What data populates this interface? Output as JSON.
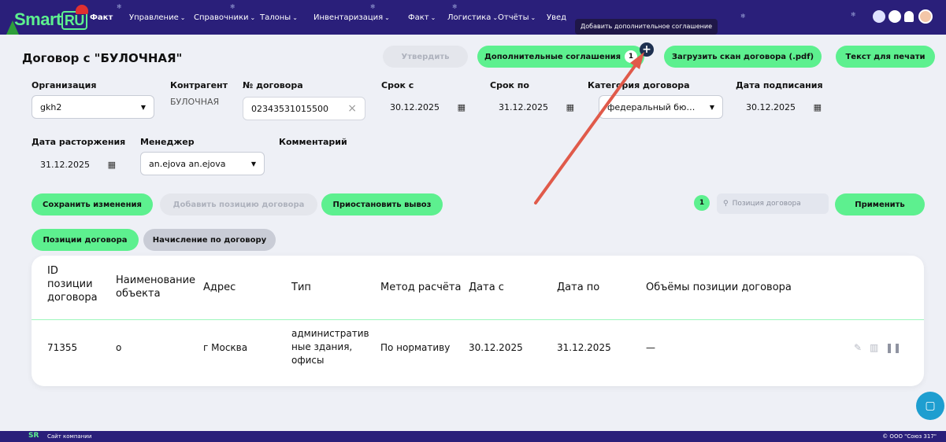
{
  "nav": {
    "logo_main": "Smart",
    "logo_ru": "RU",
    "items": [
      {
        "label": "Факт",
        "chev": ""
      },
      {
        "label": "Управление",
        "chev": "⌄"
      },
      {
        "label": "Справочники",
        "chev": "⌄"
      },
      {
        "label": "Талоны",
        "chev": "⌄"
      },
      {
        "label": "Инвентаризация",
        "chev": "⌄"
      },
      {
        "label": "Факт",
        "chev": "⌄"
      },
      {
        "label": "Логистика",
        "chev": "⌄"
      },
      {
        "label": "Отчёты",
        "chev": "⌄"
      },
      {
        "label": "Увед",
        "chev": ""
      }
    ],
    "tooltip": "Добавить дополнительное соглашение"
  },
  "header": {
    "title": "Договор с \"БУЛОЧНАЯ\"",
    "approve": "Утвердить",
    "additional": "Дополнительные соглашения",
    "additional_count": "1",
    "plus": "+",
    "upload": "Загрузить скан договора (.pdf)",
    "print": "Текст для печати"
  },
  "form": {
    "org_label": "Организация",
    "org_value": "gkh2",
    "contractor_label": "Контрагент",
    "contractor_value": "БУЛОЧНАЯ",
    "number_label": "№ договора",
    "number_value": "02343531015500",
    "from_label": "Срок с",
    "from_value": "30.12.2025",
    "to_label": "Срок по",
    "to_value": "31.12.2025",
    "category_label": "Категория договора",
    "category_value": "федеральный бю…",
    "signed_label": "Дата подписания",
    "signed_value": "30.12.2025",
    "terminate_label": "Дата расторжения",
    "terminate_value": "31.12.2025",
    "manager_label": "Менеджер",
    "manager_value": "an.ejova an.ejova",
    "comment_label": "Комментарий"
  },
  "actions": {
    "save": "Сохранить изменения",
    "add_position": "Добавить позицию договора",
    "suspend": "Приостановить вывоз",
    "count": "1",
    "search_placeholder": "Позиция договора",
    "apply": "Применить"
  },
  "tabs": {
    "positions": "Позиции договора",
    "accrual": "Начисление по договору"
  },
  "table": {
    "headers": {
      "id": [
        "ID",
        "позиции",
        "договора"
      ],
      "name": [
        "Наименование",
        "объекта"
      ],
      "address": "Адрес",
      "type": "Тип",
      "method": "Метод расчёта",
      "from": "Дата с",
      "to": "Дата по",
      "volumes": "Объёмы позиции договора"
    },
    "row": {
      "id": "71355",
      "name": "о",
      "address": "г Москва",
      "type": [
        "административ",
        "ные здания,",
        "офисы"
      ],
      "method": "По нормативу",
      "from": "30.12.2025",
      "to": "31.12.2025",
      "volumes": "—"
    }
  },
  "footer": {
    "logo": "SR",
    "site": "Сайт компании",
    "copyright": "© ООО \"Союз 317\""
  },
  "colors": {
    "nav_bg": "#2a1f7a",
    "accent_green": "#5df08f",
    "arrow": "#e05a4a",
    "page_bg": "#eef0f6"
  }
}
